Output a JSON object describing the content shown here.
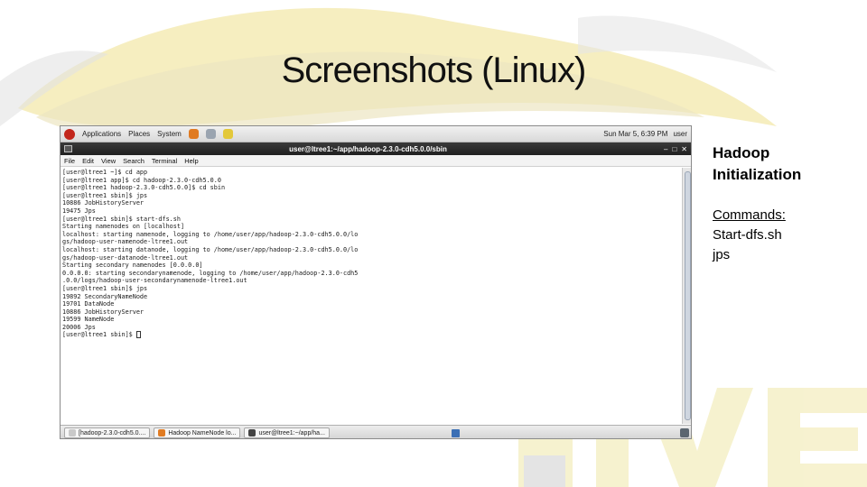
{
  "slide": {
    "title": "Screenshots (Linux)"
  },
  "screenshot": {
    "panel": {
      "menu": [
        "Applications",
        "Places",
        "System"
      ],
      "clock": "Sun Mar 5, 6:39 PM",
      "user": "user"
    },
    "window": {
      "title": "user@ltree1:~/app/hadoop-2.3.0-cdh5.0.0/sbin",
      "controls": [
        "–",
        "□",
        "✕"
      ]
    },
    "menubar": [
      "File",
      "Edit",
      "View",
      "Search",
      "Terminal",
      "Help"
    ],
    "terminal_lines": [
      "[user@ltree1 ~]$ cd app",
      "[user@ltree1 app]$ cd hadoop-2.3.0-cdh5.0.0",
      "[user@ltree1 hadoop-2.3.0-cdh5.0.0]$ cd sbin",
      "[user@ltree1 sbin]$ jps",
      "10886 JobHistoryServer",
      "19475 Jps",
      "[user@ltree1 sbin]$ start-dfs.sh",
      "Starting namenodes on [localhost]",
      "localhost: starting namenode, logging to /home/user/app/hadoop-2.3.0-cdh5.0.0/lo",
      "gs/hadoop-user-namenode-ltree1.out",
      "localhost: starting datanode, logging to /home/user/app/hadoop-2.3.0-cdh5.0.0/lo",
      "gs/hadoop-user-datanode-ltree1.out",
      "Starting secondary namenodes [0.0.0.0]",
      "0.0.0.0: starting secondarynamenode, logging to /home/user/app/hadoop-2.3.0-cdh5",
      ".0.0/logs/hadoop-user-secondarynamenode-ltree1.out",
      "[user@ltree1 sbin]$ jps",
      "19892 SecondaryNameNode",
      "19701 DataNode",
      "10886 JobHistoryServer",
      "19599 NameNode",
      "20006 Jps"
    ],
    "prompt": "[user@ltree1 sbin]$ ",
    "taskbar": [
      "[hadoop-2.3.0-cdh5.0....",
      "Hadoop NameNode lo...",
      "user@ltree1:~/app/ha..."
    ]
  },
  "side_panel": {
    "heading_line1": "Hadoop",
    "heading_line2": "Initialization",
    "commands_label": "Commands:",
    "commands": [
      "Start-dfs.sh",
      "jps"
    ]
  },
  "colors": {
    "background_art": "#f3e9a8",
    "background_art_dark": "#dcdcdc",
    "terminal_bg": "#ffffff",
    "titlebar_bg": "#2b2b2b"
  }
}
